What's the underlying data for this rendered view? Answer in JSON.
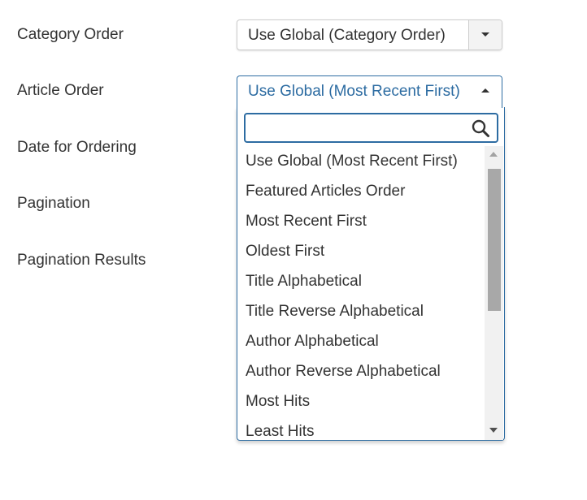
{
  "labels": {
    "category_order": "Category Order",
    "article_order": "Article Order",
    "date_for_ordering": "Date for Ordering",
    "pagination": "Pagination",
    "pagination_results": "Pagination Results"
  },
  "category_order_select": {
    "value": "Use Global (Category Order)",
    "icon": "chevron-down-icon"
  },
  "article_order_select": {
    "value": "Use Global (Most Recent First)",
    "icon": "chevron-up-icon",
    "open": true
  },
  "dropdown": {
    "search": {
      "value": "",
      "placeholder": "",
      "icon": "search-icon"
    },
    "options": [
      "Use Global (Most Recent First)",
      "Featured Articles Order",
      "Most Recent First",
      "Oldest First",
      "Title Alphabetical",
      "Title Reverse Alphabetical",
      "Author Alphabetical",
      "Author Reverse Alphabetical",
      "Most Hits",
      "Least Hits"
    ]
  },
  "colors": {
    "accent": "#2d6ca2",
    "text": "#333333",
    "border": "#cccccc"
  }
}
